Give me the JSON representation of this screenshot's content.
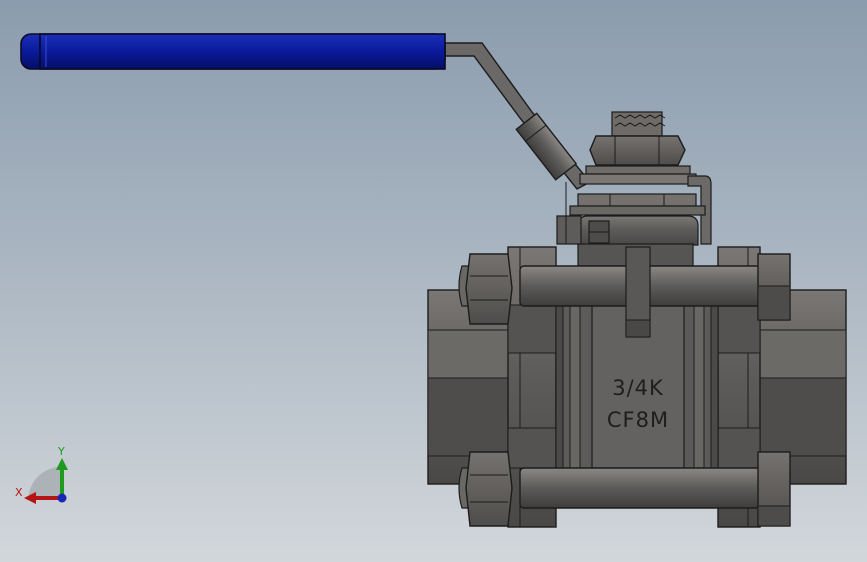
{
  "viewport": {
    "background_top": "#8b9cae",
    "background_bottom": "#d2d7db"
  },
  "valve": {
    "type": "3-piece ball valve",
    "body_marking_line1": "3/4K",
    "body_marking_line2": "CF8M",
    "body_color": "#5d5b59",
    "handle_grip_color": "#0a1a9a"
  },
  "triad": {
    "x_label": "X",
    "y_label": "Y",
    "x_color": "#b41414",
    "y_color": "#1e9b1e",
    "z_color": "#1428b4"
  }
}
